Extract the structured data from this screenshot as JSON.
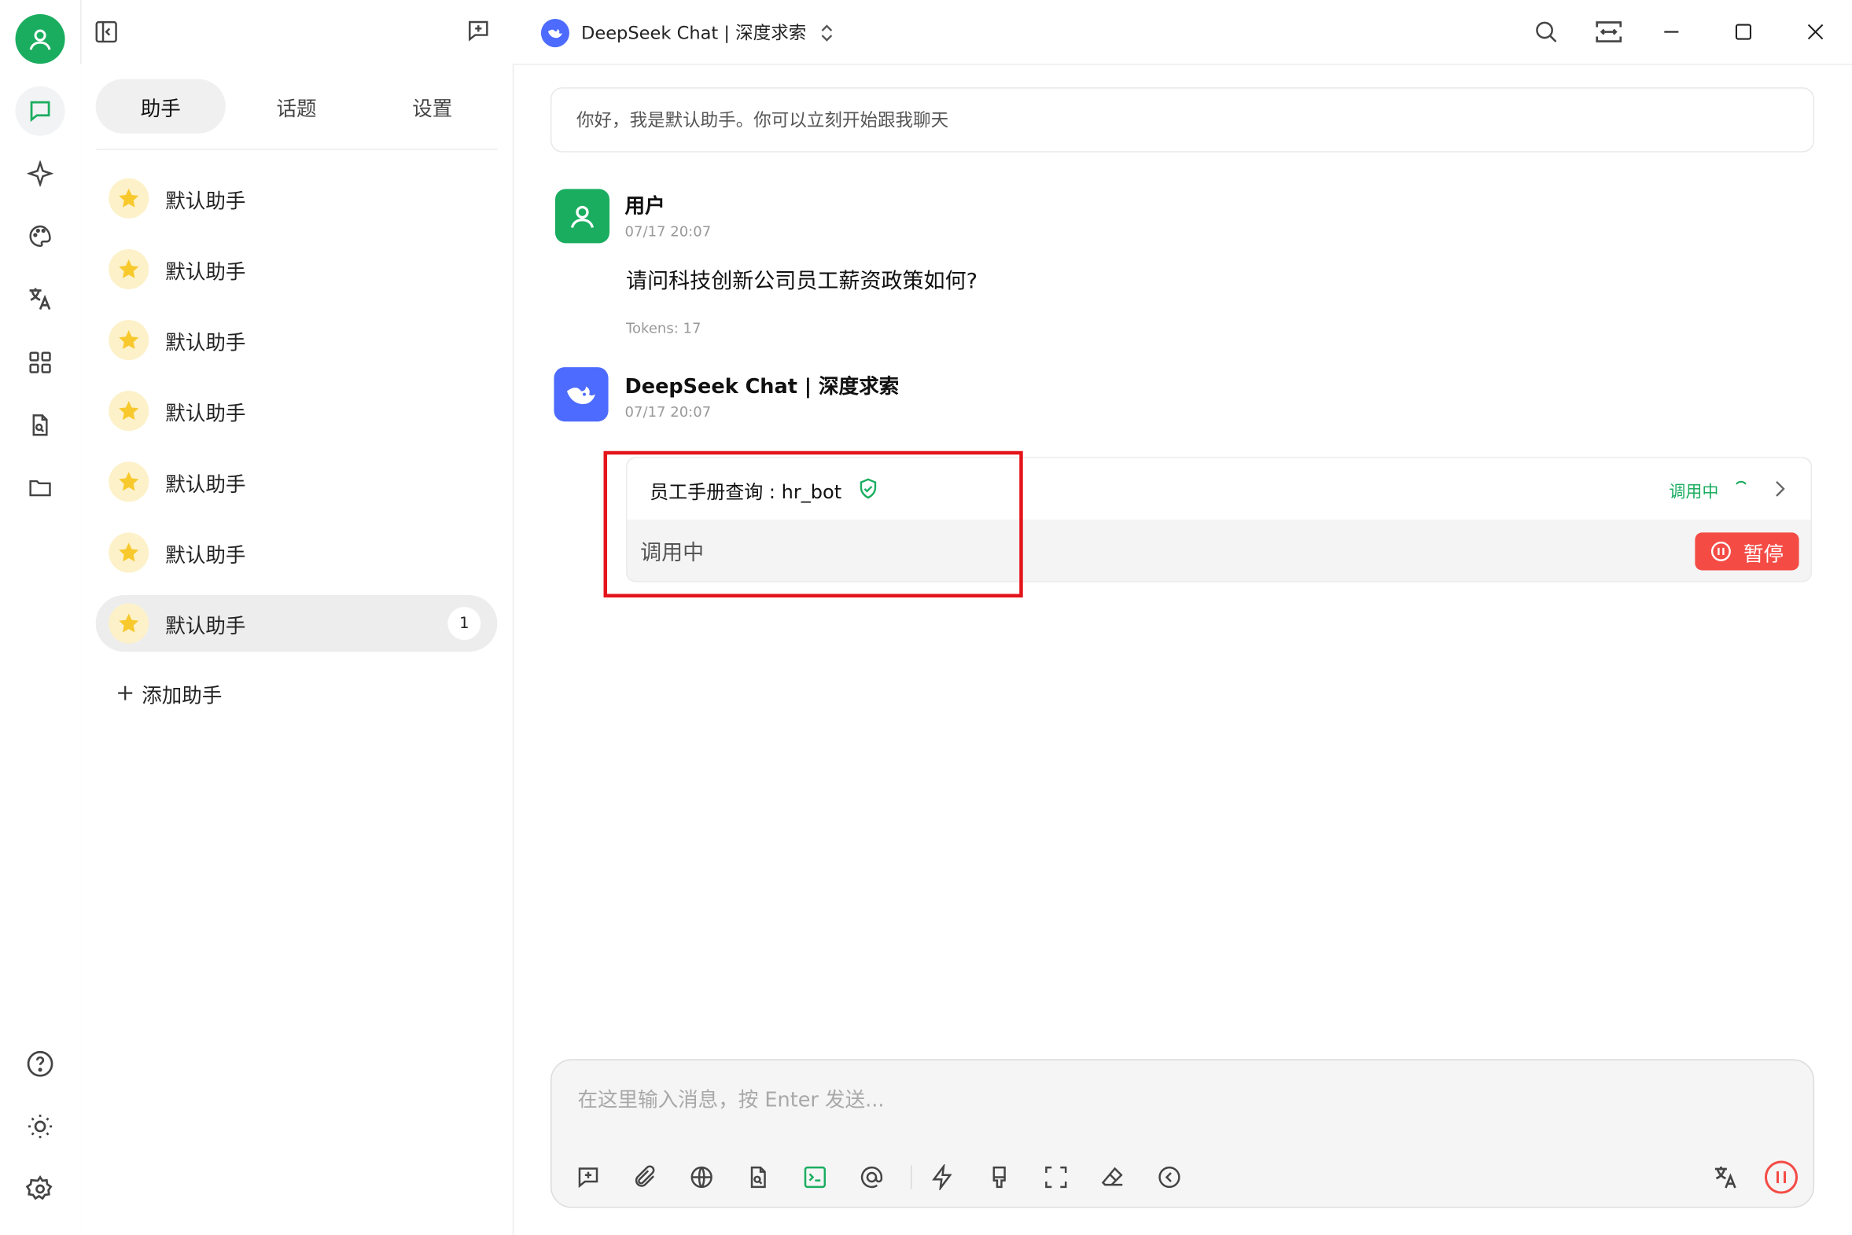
{
  "header": {
    "model_title": "DeepSeek Chat | 深度求索"
  },
  "sidebar": {
    "tabs": [
      {
        "label": "助手"
      },
      {
        "label": "话题"
      },
      {
        "label": "设置"
      }
    ],
    "assistants": [
      {
        "name": "默认助手"
      },
      {
        "name": "默认助手"
      },
      {
        "name": "默认助手"
      },
      {
        "name": "默认助手"
      },
      {
        "name": "默认助手"
      },
      {
        "name": "默认助手"
      },
      {
        "name": "默认助手",
        "badge": "1"
      }
    ],
    "add_label": "添加助手"
  },
  "chat": {
    "greeting": "你好，我是默认助手。你可以立刻开始跟我聊天",
    "user_message": {
      "sender": "用户",
      "time": "07/17 20:07",
      "text": "请问科技创新公司员工薪资政策如何?",
      "tokens": "Tokens: 17"
    },
    "bot_message": {
      "sender": "DeepSeek Chat | 深度求索",
      "time": "07/17 20:07",
      "tool_call": {
        "name": "员工手册查询 : hr_bot",
        "status": "调用中",
        "body": "调用中",
        "pause_label": "暂停"
      }
    }
  },
  "composer": {
    "placeholder": "在这里输入消息，按 Enter 发送..."
  },
  "colors": {
    "accent_green": "#1aad5f",
    "deepseek_blue": "#4d6bfe",
    "danger_red": "#f44b45",
    "star_yellow": "#f7c92c"
  }
}
